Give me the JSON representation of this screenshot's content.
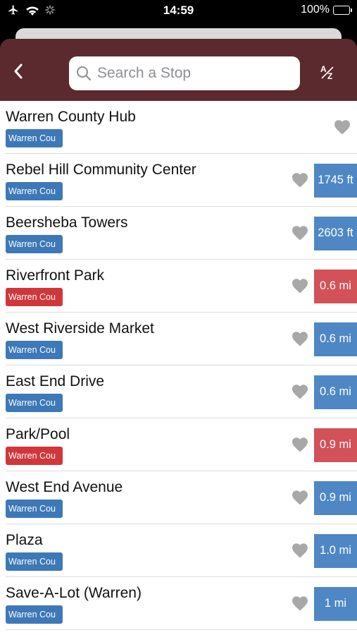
{
  "status": {
    "time": "14:59",
    "battery": "100%"
  },
  "header": {
    "search_placeholder": "Search a Stop",
    "sort_label": "AZ"
  },
  "colors": {
    "nav_bg": "#5b2a2e",
    "badge_blue": "#3d78b8",
    "badge_red": "#d0373a",
    "distance_blue": "#4f87c4",
    "distance_red": "#d25257"
  },
  "stops": [
    {
      "name": "Warren County Hub",
      "agency": "Warren Cou",
      "agency_color": "blue",
      "distance": "",
      "distance_color": ""
    },
    {
      "name": "Rebel Hill Community Center",
      "agency": "Warren Cou",
      "agency_color": "blue",
      "distance": "1745 ft",
      "distance_color": "blue"
    },
    {
      "name": "Beersheba Towers",
      "agency": "Warren Cou",
      "agency_color": "blue",
      "distance": "2603 ft",
      "distance_color": "blue"
    },
    {
      "name": "Riverfront Park",
      "agency": "Warren Cou",
      "agency_color": "red",
      "distance": "0.6 mi",
      "distance_color": "red"
    },
    {
      "name": "West Riverside Market",
      "agency": "Warren Cou",
      "agency_color": "blue",
      "distance": "0.6 mi",
      "distance_color": "blue"
    },
    {
      "name": "East End Drive",
      "agency": "Warren Cou",
      "agency_color": "blue",
      "distance": "0.6 mi",
      "distance_color": "blue"
    },
    {
      "name": "Park/Pool",
      "agency": "Warren Cou",
      "agency_color": "red",
      "distance": "0.9 mi",
      "distance_color": "red"
    },
    {
      "name": "West End Avenue",
      "agency": "Warren Cou",
      "agency_color": "blue",
      "distance": "0.9 mi",
      "distance_color": "blue"
    },
    {
      "name": "Plaza",
      "agency": "Warren Cou",
      "agency_color": "blue",
      "distance": "1.0 mi",
      "distance_color": "blue"
    },
    {
      "name": "Save-A-Lot (Warren)",
      "agency": "Warren Cou",
      "agency_color": "blue",
      "distance": "1 mi",
      "distance_color": "blue"
    }
  ]
}
